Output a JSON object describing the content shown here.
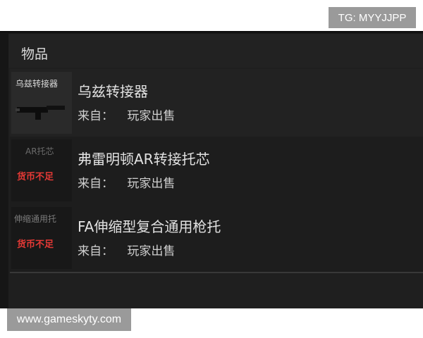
{
  "watermarks": {
    "tg": "TG: MYYJJPP",
    "site": "www.gameskyty.com"
  },
  "panel": {
    "title": "物品"
  },
  "items": [
    {
      "thumb_label": "乌兹转接器",
      "name": "乌兹转接器",
      "source_label": "来自：",
      "source_value": "玩家出售",
      "status": "",
      "icon": "uzi-adapter-icon"
    },
    {
      "thumb_label": "AR托芯",
      "name": "弗雷明顿AR转接托芯",
      "source_label": "来自：",
      "source_value": "玩家出售",
      "status": "货币不足",
      "icon": "ar-stock-core-icon"
    },
    {
      "thumb_label": "伸缩通用托",
      "name": "FA伸缩型复合通用枪托",
      "source_label": "来自：",
      "source_value": "玩家出售",
      "status": "货币不足",
      "icon": "folding-stock-icon"
    }
  ],
  "colors": {
    "insufficient": "#e53935",
    "panel_bg": "#1f1f1f"
  }
}
